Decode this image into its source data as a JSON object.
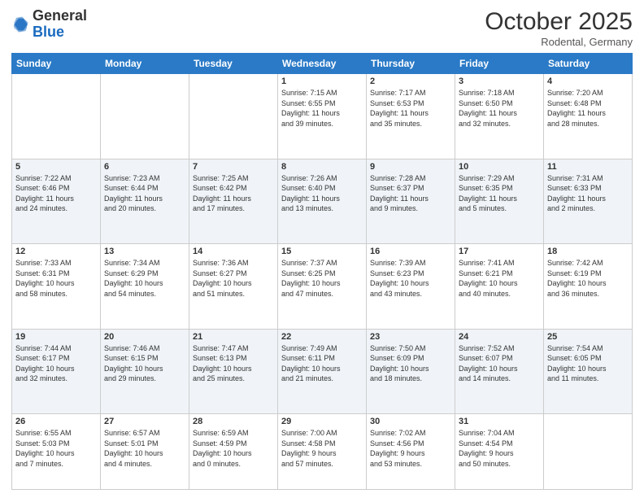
{
  "header": {
    "logo_general": "General",
    "logo_blue": "Blue",
    "month_title": "October 2025",
    "location": "Rodental, Germany"
  },
  "days_of_week": [
    "Sunday",
    "Monday",
    "Tuesday",
    "Wednesday",
    "Thursday",
    "Friday",
    "Saturday"
  ],
  "weeks": [
    [
      {
        "day": "",
        "info": ""
      },
      {
        "day": "",
        "info": ""
      },
      {
        "day": "",
        "info": ""
      },
      {
        "day": "1",
        "info": "Sunrise: 7:15 AM\nSunset: 6:55 PM\nDaylight: 11 hours\nand 39 minutes."
      },
      {
        "day": "2",
        "info": "Sunrise: 7:17 AM\nSunset: 6:53 PM\nDaylight: 11 hours\nand 35 minutes."
      },
      {
        "day": "3",
        "info": "Sunrise: 7:18 AM\nSunset: 6:50 PM\nDaylight: 11 hours\nand 32 minutes."
      },
      {
        "day": "4",
        "info": "Sunrise: 7:20 AM\nSunset: 6:48 PM\nDaylight: 11 hours\nand 28 minutes."
      }
    ],
    [
      {
        "day": "5",
        "info": "Sunrise: 7:22 AM\nSunset: 6:46 PM\nDaylight: 11 hours\nand 24 minutes."
      },
      {
        "day": "6",
        "info": "Sunrise: 7:23 AM\nSunset: 6:44 PM\nDaylight: 11 hours\nand 20 minutes."
      },
      {
        "day": "7",
        "info": "Sunrise: 7:25 AM\nSunset: 6:42 PM\nDaylight: 11 hours\nand 17 minutes."
      },
      {
        "day": "8",
        "info": "Sunrise: 7:26 AM\nSunset: 6:40 PM\nDaylight: 11 hours\nand 13 minutes."
      },
      {
        "day": "9",
        "info": "Sunrise: 7:28 AM\nSunset: 6:37 PM\nDaylight: 11 hours\nand 9 minutes."
      },
      {
        "day": "10",
        "info": "Sunrise: 7:29 AM\nSunset: 6:35 PM\nDaylight: 11 hours\nand 5 minutes."
      },
      {
        "day": "11",
        "info": "Sunrise: 7:31 AM\nSunset: 6:33 PM\nDaylight: 11 hours\nand 2 minutes."
      }
    ],
    [
      {
        "day": "12",
        "info": "Sunrise: 7:33 AM\nSunset: 6:31 PM\nDaylight: 10 hours\nand 58 minutes."
      },
      {
        "day": "13",
        "info": "Sunrise: 7:34 AM\nSunset: 6:29 PM\nDaylight: 10 hours\nand 54 minutes."
      },
      {
        "day": "14",
        "info": "Sunrise: 7:36 AM\nSunset: 6:27 PM\nDaylight: 10 hours\nand 51 minutes."
      },
      {
        "day": "15",
        "info": "Sunrise: 7:37 AM\nSunset: 6:25 PM\nDaylight: 10 hours\nand 47 minutes."
      },
      {
        "day": "16",
        "info": "Sunrise: 7:39 AM\nSunset: 6:23 PM\nDaylight: 10 hours\nand 43 minutes."
      },
      {
        "day": "17",
        "info": "Sunrise: 7:41 AM\nSunset: 6:21 PM\nDaylight: 10 hours\nand 40 minutes."
      },
      {
        "day": "18",
        "info": "Sunrise: 7:42 AM\nSunset: 6:19 PM\nDaylight: 10 hours\nand 36 minutes."
      }
    ],
    [
      {
        "day": "19",
        "info": "Sunrise: 7:44 AM\nSunset: 6:17 PM\nDaylight: 10 hours\nand 32 minutes."
      },
      {
        "day": "20",
        "info": "Sunrise: 7:46 AM\nSunset: 6:15 PM\nDaylight: 10 hours\nand 29 minutes."
      },
      {
        "day": "21",
        "info": "Sunrise: 7:47 AM\nSunset: 6:13 PM\nDaylight: 10 hours\nand 25 minutes."
      },
      {
        "day": "22",
        "info": "Sunrise: 7:49 AM\nSunset: 6:11 PM\nDaylight: 10 hours\nand 21 minutes."
      },
      {
        "day": "23",
        "info": "Sunrise: 7:50 AM\nSunset: 6:09 PM\nDaylight: 10 hours\nand 18 minutes."
      },
      {
        "day": "24",
        "info": "Sunrise: 7:52 AM\nSunset: 6:07 PM\nDaylight: 10 hours\nand 14 minutes."
      },
      {
        "day": "25",
        "info": "Sunrise: 7:54 AM\nSunset: 6:05 PM\nDaylight: 10 hours\nand 11 minutes."
      }
    ],
    [
      {
        "day": "26",
        "info": "Sunrise: 6:55 AM\nSunset: 5:03 PM\nDaylight: 10 hours\nand 7 minutes."
      },
      {
        "day": "27",
        "info": "Sunrise: 6:57 AM\nSunset: 5:01 PM\nDaylight: 10 hours\nand 4 minutes."
      },
      {
        "day": "28",
        "info": "Sunrise: 6:59 AM\nSunset: 4:59 PM\nDaylight: 10 hours\nand 0 minutes."
      },
      {
        "day": "29",
        "info": "Sunrise: 7:00 AM\nSunset: 4:58 PM\nDaylight: 9 hours\nand 57 minutes."
      },
      {
        "day": "30",
        "info": "Sunrise: 7:02 AM\nSunset: 4:56 PM\nDaylight: 9 hours\nand 53 minutes."
      },
      {
        "day": "31",
        "info": "Sunrise: 7:04 AM\nSunset: 4:54 PM\nDaylight: 9 hours\nand 50 minutes."
      },
      {
        "day": "",
        "info": ""
      }
    ]
  ]
}
